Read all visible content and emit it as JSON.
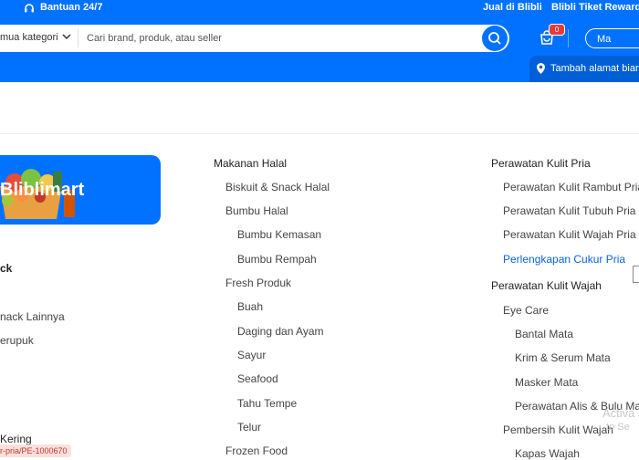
{
  "topbar": {
    "help_label": "Bantuan 24/7",
    "sell_label": "Jual di Blibli",
    "rewards_label": "Blibli Tiket Rewards"
  },
  "search": {
    "category_label": "mua kategori",
    "placeholder": "Cari brand, produk, atau seller"
  },
  "cart": {
    "count": "0"
  },
  "login_label": "Ma",
  "address_label": "Tambah alamat biar",
  "banner": {
    "title": "Bliblimart"
  },
  "left_column": {
    "heading_partial": "ck",
    "items": [
      "nack Lainnya",
      "erupuk"
    ],
    "bottom_heading": "Kering",
    "url_tag": "r-pria/PE-1000670"
  },
  "middle_column": {
    "heading": "Makanan Halal",
    "items": [
      "Biskuit & Snack Halal",
      "Bumbu Halal",
      "Bumbu Kemasan",
      "Bumbu Rempah",
      "Fresh Produk",
      "Buah",
      "Daging dan Ayam",
      "Sayur",
      "Seafood",
      "Tahu Tempe",
      "Telur",
      "Frozen Food"
    ]
  },
  "right_column": {
    "heading1": "Perawatan Kulit Pria",
    "items1": [
      "Perawatan Kulit Rambut Pria",
      "Perawatan Kulit Tubuh Pria",
      "Perawatan Kulit Wajah Pria",
      "Perlengkapan Cukur Pria"
    ],
    "heading2": "Perawatan Kulit Wajah",
    "items2": [
      "Eye Care",
      "Bantal Mata",
      "Krim & Serum Mata",
      "Masker Mata",
      "Perawatan Alis & Bulu Mata",
      "Pembersih Kulit Wajah",
      "Kapas Wajah"
    ]
  },
  "watermark": {
    "line1": "Activa",
    "line2": "to Se"
  },
  "colors": {
    "brand_blue": "#0072ff",
    "link_active": "#0a64d6",
    "badge_red": "#e83a3a"
  }
}
